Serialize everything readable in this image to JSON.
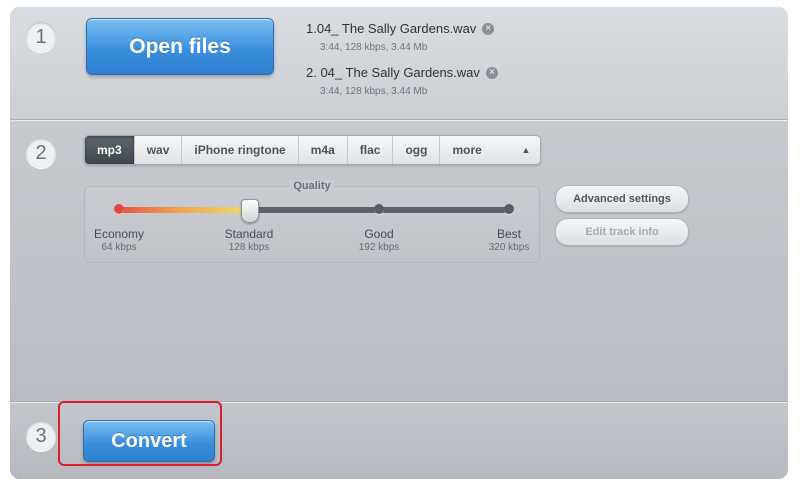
{
  "steps": [
    "1",
    "2",
    "3"
  ],
  "open_files_label": "Open files",
  "files": [
    {
      "name": "1.04_ The Sally Gardens.wav",
      "meta": "3:44, 128 kbps, 3.44 Mb"
    },
    {
      "name": "2. 04_ The Sally Gardens.wav",
      "meta": "3:44, 128 kbps, 3.44 Mb"
    }
  ],
  "formats": [
    "mp3",
    "wav",
    "iPhone ringtone",
    "m4a",
    "flac",
    "ogg",
    "more"
  ],
  "selected_format": "mp3",
  "quality": {
    "title": "Quality",
    "selected": "Standard",
    "level_fraction": 0.333,
    "levels": [
      {
        "name": "Economy",
        "bitrate": "64 kbps"
      },
      {
        "name": "Standard",
        "bitrate": "128 kbps"
      },
      {
        "name": "Good",
        "bitrate": "192 kbps"
      },
      {
        "name": "Best",
        "bitrate": "320 kbps"
      }
    ]
  },
  "advanced_settings_label": "Advanced settings",
  "edit_track_info_label": "Edit track info",
  "convert_label": "Convert",
  "colors": {
    "accent_blue": "#3a8fdd",
    "highlight_red": "#d8202a"
  }
}
